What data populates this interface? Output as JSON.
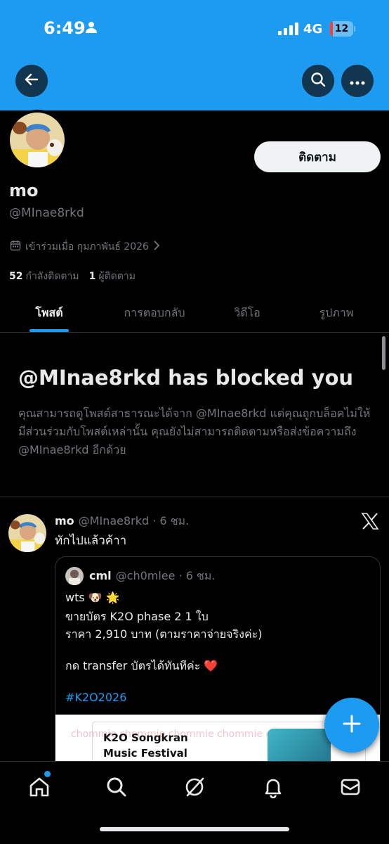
{
  "status_bar": {
    "time": "6:49",
    "network": "4G",
    "battery": "12",
    "battery_level": 0.12
  },
  "header": {
    "icons": [
      "back-arrow-icon",
      "search-icon",
      "more-icon"
    ]
  },
  "profile": {
    "display_name": "mo",
    "handle": "@MInae8rkd",
    "follow_label": "ติดตาม",
    "joined": "เข้าร่วมเมื่อ กุมภาพันธ์ 2026",
    "following_count": "52",
    "following_label": "กำลังติดตาม",
    "followers_count": "1",
    "followers_label": "ผู้ติดตาม"
  },
  "tabs": [
    {
      "label": "โพสต์",
      "active": true
    },
    {
      "label": "การตอบกลับ",
      "active": false
    },
    {
      "label": "วิดีโอ",
      "active": false
    },
    {
      "label": "รูปภาพ",
      "active": false
    }
  ],
  "blocked": {
    "title": "@MInae8rkd has blocked you",
    "body": "คุณสามารถดูโพสต์สาธารณะได้จาก @MInae8rkd แต่คุณถูกบล็อคไม่ให้มีส่วนร่วมกับโพสต์เหล่านั้น คุณยังไม่สามารถติดตามหรือส่งข้อความถึง @MInae8rkd อีกด้วย"
  },
  "post": {
    "name": "mo",
    "meta": "@MInae8rkd · 6 ชม.",
    "text": "ทักไปแล้วค้าา",
    "quote": {
      "name": "cml",
      "meta": "@ch0mlee · 6 ชม.",
      "lines": [
        "wts 🐶 🌟",
        "ขายบัตร K2O phase 2 1 ใบ",
        "ราคา 2,910 บาท (ตามราคาจ่ายจริงค่ะ)",
        "กด transfer บัตรได้ทันทีค่ะ ❤️"
      ],
      "hashtag": "#K2O2026",
      "media": {
        "watermark": "chommie chommie chommie chommie ch",
        "event_line1": "K2O Songkran",
        "event_line2": "Music Festival"
      }
    }
  },
  "bottom_nav": [
    "home-icon",
    "search-icon",
    "grok-icon",
    "notifications-icon",
    "messages-icon"
  ],
  "colors": {
    "accent": "#1d9bf0",
    "background": "#000000",
    "muted": "#71767b",
    "text": "#e7e9ea"
  }
}
